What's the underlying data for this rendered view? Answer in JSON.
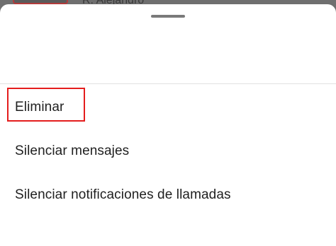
{
  "background": {
    "contact_name": "R. Alejandro"
  },
  "sheet": {
    "menu": [
      {
        "label": "Eliminar"
      },
      {
        "label": "Silenciar mensajes"
      },
      {
        "label": "Silenciar notificaciones de llamadas"
      }
    ]
  },
  "colors": {
    "highlight": "#e41d1d",
    "scrim": "#6f6f6f",
    "text": "#1f1f1f"
  }
}
